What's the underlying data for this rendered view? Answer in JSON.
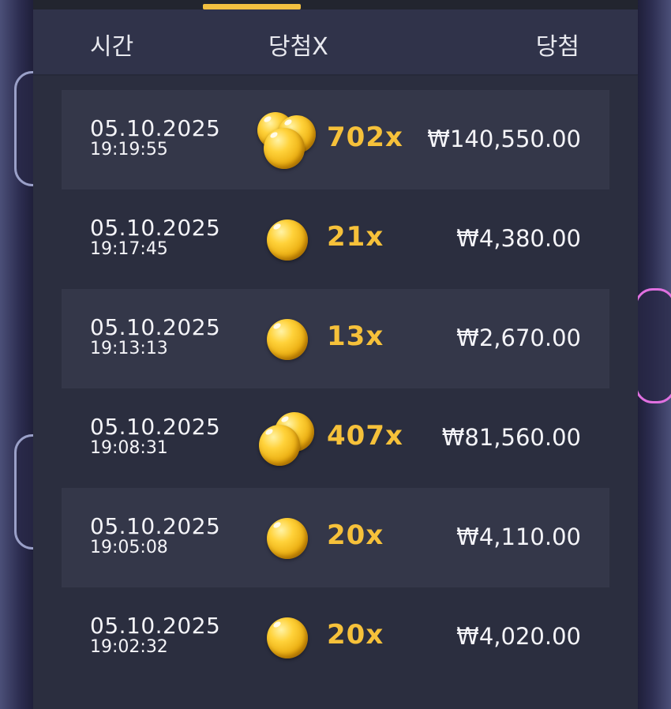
{
  "header": {
    "col_time": "시간",
    "col_multiplier": "당첨X",
    "col_win": "당첨"
  },
  "rows": [
    {
      "date": "05.10.2025",
      "time": "19:19:55",
      "multiplier": "702x",
      "amount": "₩140,550.00",
      "coin_icon": "coin-pile-icon"
    },
    {
      "date": "05.10.2025",
      "time": "19:17:45",
      "multiplier": "21x",
      "amount": "₩4,380.00",
      "coin_icon": "coin-icon"
    },
    {
      "date": "05.10.2025",
      "time": "19:13:13",
      "multiplier": "13x",
      "amount": "₩2,670.00",
      "coin_icon": "coin-icon"
    },
    {
      "date": "05.10.2025",
      "time": "19:08:31",
      "multiplier": "407x",
      "amount": "₩81,560.00",
      "coin_icon": "coin-stack-icon"
    },
    {
      "date": "05.10.2025",
      "time": "19:05:08",
      "multiplier": "20x",
      "amount": "₩4,110.00",
      "coin_icon": "coin-icon"
    },
    {
      "date": "05.10.2025",
      "time": "19:02:32",
      "multiplier": "20x",
      "amount": "₩4,020.00",
      "coin_icon": "coin-icon"
    }
  ],
  "colors": {
    "accent": "#f2c040",
    "multiplier_text": "#f6c13a",
    "panel_bg": "#2b2e3f",
    "row_alt_bg": "#343749"
  }
}
